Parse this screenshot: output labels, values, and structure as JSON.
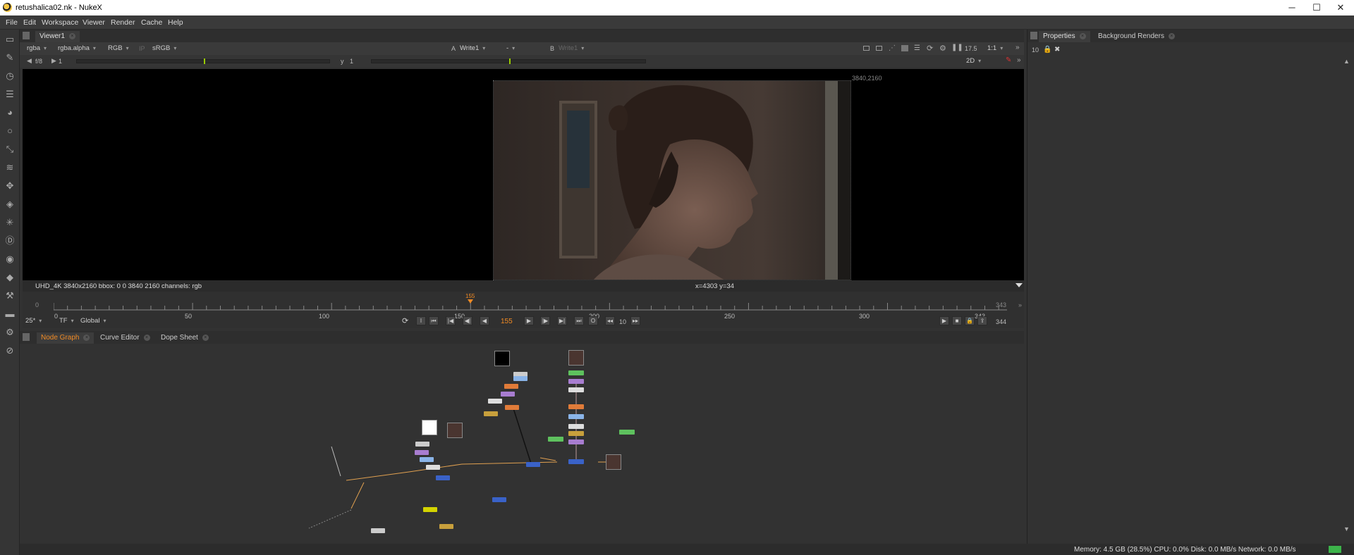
{
  "window": {
    "title": "retushalica02.nk - NukeX",
    "minimize": "─",
    "maximize": "☐",
    "close": "✕"
  },
  "menu": [
    "File",
    "Edit",
    "Workspace",
    "Viewer",
    "Render",
    "Cache",
    "Help"
  ],
  "toolbar_icons": [
    "image-icon",
    "draw-icon",
    "time-icon",
    "channel-icon",
    "color-icon",
    "filter-icon",
    "keyer-icon",
    "merge-icon",
    "transform-icon",
    "3d-icon",
    "particles-icon",
    "deep-icon",
    "views-icon",
    "metadata-icon",
    "toolsets-icon",
    "other-icon",
    "furnace-icon",
    "cara-icon"
  ],
  "viewer": {
    "tab": "Viewer1",
    "channels": "rgba",
    "alpha": "rgba.alpha",
    "display": "RGB",
    "ip": "IP",
    "lut": "sRGB",
    "input_a_label": "A",
    "input_a": "Write1",
    "wipe": "-",
    "input_b_label": "B",
    "input_b": "Write1",
    "zoom_value": "17.5",
    "ratio": "1:1",
    "view_mode": "2D",
    "fstop": "f/8",
    "gain": "1",
    "gamma_label": "y",
    "gamma": "1",
    "bbox_corner": "3840,2160",
    "info_left": "UHD_4K 3840x2160  bbox: 0 0 3840 2160 channels: rgb",
    "info_coords": "x=4303 y=34"
  },
  "timeline": {
    "start": "0",
    "end": "343",
    "current_marker": "155",
    "ticks": [
      "0",
      "50",
      "100",
      "150",
      "200",
      "250",
      "300",
      "343"
    ],
    "fps": "25*",
    "tf": "TF",
    "scope": "Global",
    "current_frame": "155",
    "increment": "10",
    "out_frame": "344"
  },
  "panels": {
    "node_graph": "Node Graph",
    "curve_editor": "Curve Editor",
    "dope_sheet": "Dope Sheet",
    "properties": "Properties",
    "background_renders": "Background Renders",
    "max_panels": "10"
  },
  "status": "Memory: 4.5 GB (28.5%) CPU: 0.0% Disk: 0.0 MB/s Network: 0.0 MB/s",
  "colors": {
    "accent": "#f08a24",
    "status_ok": "#3cb34a"
  }
}
